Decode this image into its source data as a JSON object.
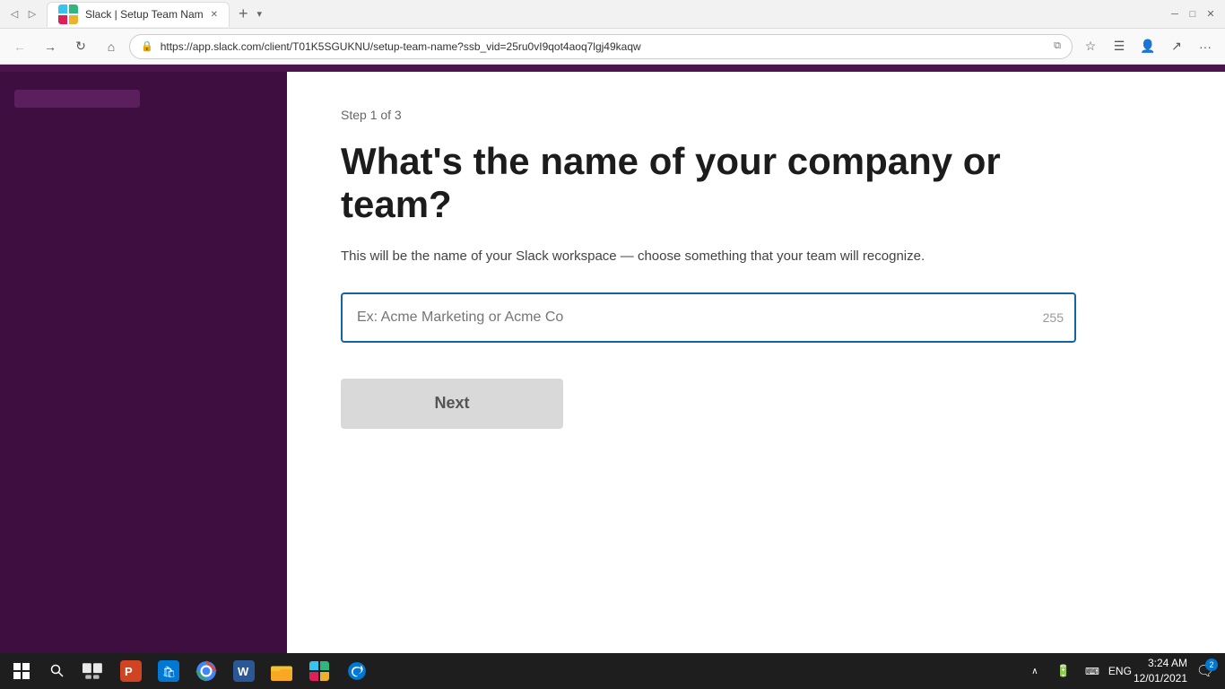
{
  "browser": {
    "tab_title": "Slack | Setup Team Nam",
    "url": "https://app.slack.com/client/T01K5SGUKNU/setup-team-name?ssb_vid=25ru0vI9qot4aoq7lgj49kaqw",
    "nav": {
      "back": "←",
      "forward": "→",
      "refresh": "↻",
      "home": "⌂"
    }
  },
  "page": {
    "step_label": "Step 1 of 3",
    "heading": "What's the name of your company or team?",
    "subtitle": "This will be the name of your Slack workspace — choose something that your team will recognize.",
    "input_placeholder": "Ex: Acme Marketing or Acme Co",
    "char_count": "255",
    "next_button_label": "Next"
  },
  "taskbar": {
    "time": "3:24 AM",
    "date": "12/01/2021",
    "language": "ENG",
    "notification_count": "2"
  }
}
